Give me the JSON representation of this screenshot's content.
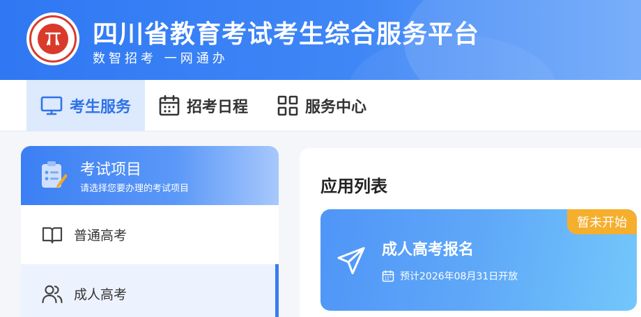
{
  "header": {
    "title": "四川省教育考试考生综合服务平台",
    "slogan": "数智招考  一网通办",
    "logo_name": "seal-logo"
  },
  "nav": {
    "items": [
      {
        "label": "考生服务",
        "icon": "monitor-icon",
        "active": true
      },
      {
        "label": "招考日程",
        "icon": "calendar-icon",
        "active": false
      },
      {
        "label": "服务中心",
        "icon": "grid-icon",
        "active": false
      }
    ]
  },
  "sidebar": {
    "title": "考试项目",
    "subtitle": "请选择您要办理的考试项目",
    "items": [
      {
        "label": "普通高考",
        "icon": "book-icon",
        "active": false
      },
      {
        "label": "成人高考",
        "icon": "users-icon",
        "active": true
      }
    ]
  },
  "main": {
    "title": "应用列表",
    "apps": [
      {
        "name": "成人高考报名",
        "badge": "暂未开始",
        "date_text": "预计2026年08月31日开放",
        "icon": "paper-plane-icon"
      }
    ]
  },
  "colors": {
    "primary": "#2f78f3",
    "active_nav_bg": "#dde9fc",
    "badge": "#f6ae2d",
    "seal_red": "#d93a2b"
  }
}
